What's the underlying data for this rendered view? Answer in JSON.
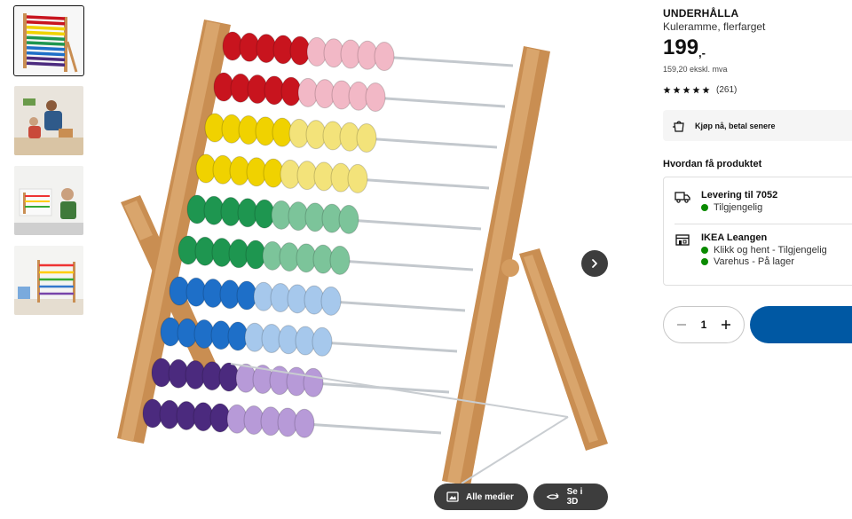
{
  "product": {
    "name": "UNDERHÅLLA",
    "description": "Kuleramme, flerfarget",
    "price_main": "199",
    "price_suffix": ",-",
    "price_ex_vat": "159,20 ekskl. mva",
    "rating_count": "(261)",
    "rating_stars": 5
  },
  "gallery": {
    "thumbnails": [
      "abacus-product",
      "family-playing",
      "child-with-abacus",
      "abacus-in-room"
    ],
    "active_index": 0,
    "all_media_label": "Alle medier",
    "view_3d_label": "Se i 3D"
  },
  "payment": {
    "klarna_label": "Kjøp nå, betal senere"
  },
  "fulfillment": {
    "heading": "Hvordan få produktet",
    "delivery": {
      "title": "Levering til 7052",
      "status": "Tilgjengelig",
      "icon": "truck-icon"
    },
    "store": {
      "title": "IKEA Leangen",
      "status_1": "Klikk og hent - Tilgjengelig",
      "status_2": "Varehus - På lager",
      "icon": "store-icon"
    },
    "status_color": "#0a8a00"
  },
  "cart": {
    "quantity": "1",
    "button_color": "#0058a3"
  },
  "bead_colors": {
    "red": [
      "#c8141e",
      "#f2b8c6"
    ],
    "yellow": [
      "#f0d200",
      "#f3e37a"
    ],
    "green": [
      "#1e9650",
      "#7cc49a"
    ],
    "blue": [
      "#1e6fc8",
      "#a6c8ec"
    ],
    "purple": [
      "#4b2a7e",
      "#b79ad8"
    ]
  }
}
